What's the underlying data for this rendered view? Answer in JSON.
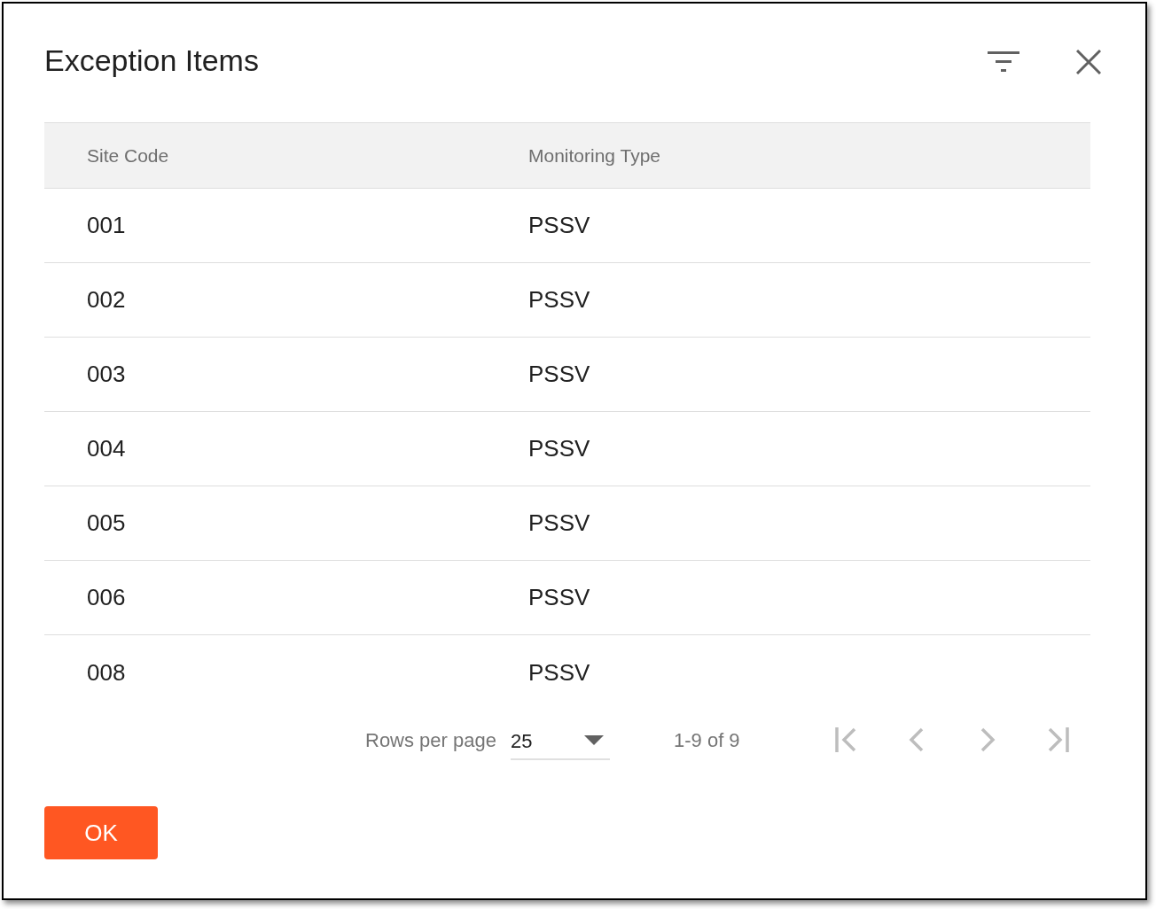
{
  "dialog": {
    "title": "Exception Items"
  },
  "table": {
    "columns": [
      "Site Code",
      "Monitoring Type"
    ],
    "rows": [
      [
        "001",
        "PSSV"
      ],
      [
        "002",
        "PSSV"
      ],
      [
        "003",
        "PSSV"
      ],
      [
        "004",
        "PSSV"
      ],
      [
        "005",
        "PSSV"
      ],
      [
        "006",
        "PSSV"
      ],
      [
        "008",
        "PSSV"
      ]
    ]
  },
  "pagination": {
    "rows_per_page_label": "Rows per page",
    "rows_per_page": "25",
    "range": "1-9 of 9",
    "buttons": [
      {
        "kind": "first",
        "disabled": true
      },
      {
        "kind": "previous",
        "disabled": true
      },
      {
        "kind": "next",
        "disabled": true
      },
      {
        "kind": "last",
        "disabled": true
      }
    ]
  },
  "actions": [
    {
      "label": "OK"
    }
  ]
}
